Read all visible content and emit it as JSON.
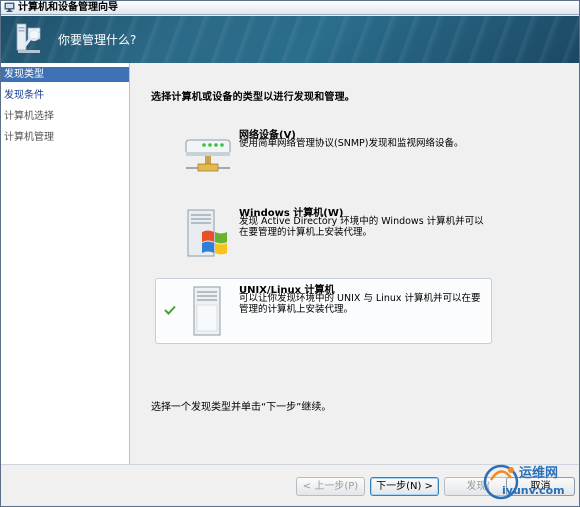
{
  "window": {
    "title": "计算机和设备管理向导"
  },
  "header": {
    "heading": "你要管理什么?"
  },
  "nav": {
    "items": [
      {
        "label": "发现类型",
        "state": "active"
      },
      {
        "label": "发现条件",
        "state": "link"
      },
      {
        "label": "计算机选择",
        "state": "disabled"
      },
      {
        "label": "计算机管理",
        "state": "disabled"
      }
    ]
  },
  "content": {
    "prompt": "选择计算机或设备的类型以进行发现和管理。",
    "options": [
      {
        "title": "网络设备(V)",
        "description": "使用简单网络管理协议(SNMP)发现和监视网络设备。",
        "icon": "network-device-icon",
        "selected": false
      },
      {
        "title": "Windows 计算机(W)",
        "description": "发现 Active Directory 环境中的 Windows 计算机并可以在要管理的计算机上安装代理。",
        "icon": "windows-computer-icon",
        "selected": false
      },
      {
        "title": "UNIX/Linux 计算机",
        "description": "可以让你发现环境中的 UNIX 与 Linux 计算机并可以在要管理的计算机上安装代理。",
        "icon": "unix-computer-icon",
        "selected": true
      }
    ],
    "hint": "选择一个发现类型并单击“下一步”继续。"
  },
  "footer": {
    "back_label": "< 上一步(P)",
    "next_label": "下一步(N) >",
    "discover_label": "发现(",
    "cancel_label": "取消"
  },
  "watermark": {
    "line1": "运维网",
    "line2": "iyunv.com"
  },
  "colors": {
    "header_bg": "#2b6a87",
    "nav_active": "#3f72b5",
    "link": "#1a3d8f",
    "watermark": "#2a6fb8"
  }
}
